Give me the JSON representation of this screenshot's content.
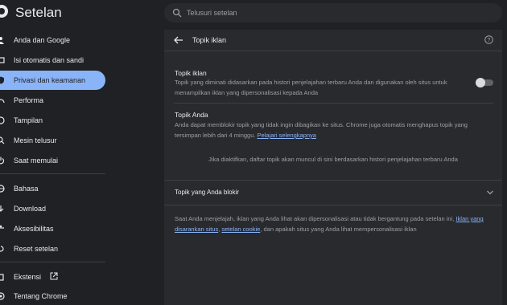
{
  "header": {
    "title": "Setelan",
    "search_placeholder": "Telusuri setelan"
  },
  "sidebar": {
    "items": [
      {
        "label": "Anda dan Google",
        "icon": "person-icon"
      },
      {
        "label": "Isi otomatis dan sandi",
        "icon": "autofill-icon"
      },
      {
        "label": "Privasi dan keamanan",
        "icon": "shield-icon",
        "active": true
      },
      {
        "label": "Performa",
        "icon": "speedometer-icon"
      },
      {
        "label": "Tampilan",
        "icon": "palette-icon"
      },
      {
        "label": "Mesin telusur",
        "icon": "search-icon"
      },
      {
        "label": "Saat memulai",
        "icon": "power-icon"
      },
      {
        "label": "Bahasa",
        "icon": "globe-icon"
      },
      {
        "label": "Download",
        "icon": "download-icon"
      },
      {
        "label": "Aksesibilitas",
        "icon": "accessibility-icon"
      },
      {
        "label": "Reset setelan",
        "icon": "reset-icon"
      },
      {
        "label": "Ekstensi",
        "icon": "puzzle-icon"
      },
      {
        "label": "Tentang Chrome",
        "icon": "chrome-icon"
      }
    ]
  },
  "main": {
    "page_title": "Topik iklan",
    "ad_topics": {
      "title": "Topik iklan",
      "description": "Topik yang diminati didasarkan pada histori penjelajahan terbaru Anda dan digunakan oleh situs untuk menampilkan iklan yang dipersonalisasi kepada Anda",
      "enabled": false
    },
    "your_topics": {
      "title": "Topik Anda",
      "description": "Anda dapat memblokir topik yang tidak ingin dibagikan ke situs. Chrome juga otomatis menghapus topik yang tersimpan lebih dari 4 minggu.",
      "link": "Pelajari selengkapnya"
    },
    "empty_message": "Jika diaktifkan, daftar topik akan muncul di sini berdasarkan histori penjelajahan terbaru Anda",
    "blocked_topics_label": "Topik yang Anda blokir",
    "footer": {
      "text_before": "Saat Anda menjelajah, iklan yang Anda lihat akan dipersonalisasi atau tidak bergantung pada setelan ini,",
      "link1": "Iklan yang disarankan situs",
      "sep": ",",
      "link2": "setelan cookie",
      "text_after": ", dan apakah situs yang Anda lihat mempersonalisasi iklan"
    }
  },
  "colors": {
    "background": "#202124",
    "panel": "#292a2d",
    "accent": "#8ab4f8",
    "text": "#e8eaed",
    "secondary_text": "#9aa0a6"
  }
}
